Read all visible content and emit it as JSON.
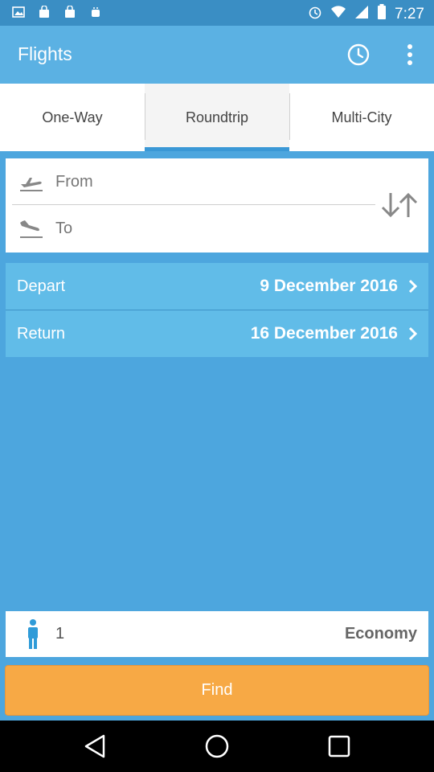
{
  "status_bar": {
    "time": "7:27",
    "left_icons": [
      "image-icon",
      "bag-icon",
      "bag-icon",
      "android-icon"
    ],
    "right_icons": [
      "alarm-icon",
      "wifi-icon",
      "signal-icon",
      "battery-icon"
    ]
  },
  "app_bar": {
    "title": "Flights",
    "actions": [
      "history-icon",
      "more-vert-icon"
    ]
  },
  "tabs": [
    {
      "label": "One-Way",
      "active": false
    },
    {
      "label": "Roundtrip",
      "active": true
    },
    {
      "label": "Multi-City",
      "active": false
    }
  ],
  "route": {
    "from_label": "From",
    "to_label": "To",
    "swap_icon": "swap-arrows-icon"
  },
  "dates": {
    "depart_label": "Depart",
    "depart_value": "9 December 2016",
    "return_label": "Return",
    "return_value": "16 December 2016"
  },
  "passengers": {
    "count": "1",
    "cabin_class": "Economy"
  },
  "find_button": {
    "label": "Find"
  },
  "colors": {
    "status_bar": "#3a8ec4",
    "app_bar": "#5bb1e3",
    "background": "#4da6de",
    "date_card": "#61bce8",
    "find_button": "#f7a945",
    "tab_indicator": "#3a98d6"
  }
}
